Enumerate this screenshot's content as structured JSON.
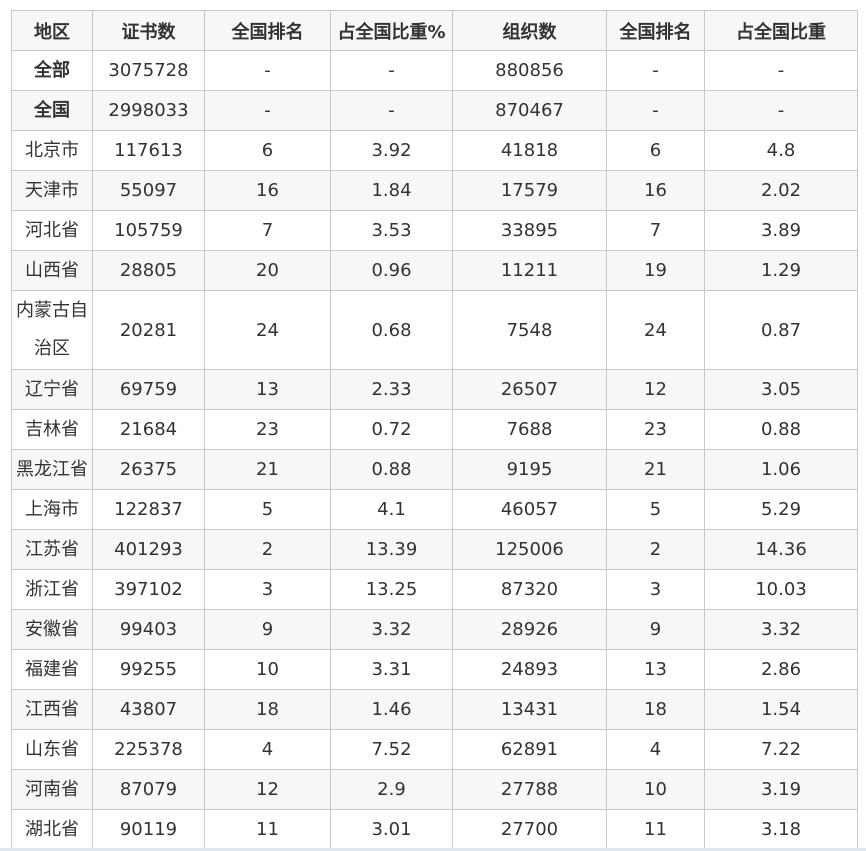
{
  "headers": [
    "地区",
    "证书数",
    "全国排名",
    "占全国比重%",
    "组织数",
    "全国排名",
    "占全国比重"
  ],
  "rows": [
    {
      "region": "全部",
      "bold": true,
      "certs": "3075728",
      "cert_rank": "-",
      "cert_share": "-",
      "orgs": "880856",
      "org_rank": "-",
      "org_share": "-"
    },
    {
      "region": "全国",
      "bold": true,
      "certs": "2998033",
      "cert_rank": "-",
      "cert_share": "-",
      "orgs": "870467",
      "org_rank": "-",
      "org_share": "-"
    },
    {
      "region": "北京市",
      "certs": "117613",
      "cert_rank": "6",
      "cert_share": "3.92",
      "orgs": "41818",
      "org_rank": "6",
      "org_share": "4.8"
    },
    {
      "region": "天津市",
      "certs": "55097",
      "cert_rank": "16",
      "cert_share": "1.84",
      "orgs": "17579",
      "org_rank": "16",
      "org_share": "2.02"
    },
    {
      "region": "河北省",
      "certs": "105759",
      "cert_rank": "7",
      "cert_share": "3.53",
      "orgs": "33895",
      "org_rank": "7",
      "org_share": "3.89"
    },
    {
      "region": "山西省",
      "certs": "28805",
      "cert_rank": "20",
      "cert_share": "0.96",
      "orgs": "11211",
      "org_rank": "19",
      "org_share": "1.29"
    },
    {
      "region": "内蒙古自治区",
      "tall": true,
      "certs": "20281",
      "cert_rank": "24",
      "cert_share": "0.68",
      "orgs": "7548",
      "org_rank": "24",
      "org_share": "0.87"
    },
    {
      "region": "辽宁省",
      "certs": "69759",
      "cert_rank": "13",
      "cert_share": "2.33",
      "orgs": "26507",
      "org_rank": "12",
      "org_share": "3.05"
    },
    {
      "region": "吉林省",
      "certs": "21684",
      "cert_rank": "23",
      "cert_share": "0.72",
      "orgs": "7688",
      "org_rank": "23",
      "org_share": "0.88"
    },
    {
      "region": "黑龙江省",
      "certs": "26375",
      "cert_rank": "21",
      "cert_share": "0.88",
      "orgs": "9195",
      "org_rank": "21",
      "org_share": "1.06"
    },
    {
      "region": "上海市",
      "certs": "122837",
      "cert_rank": "5",
      "cert_share": "4.1",
      "orgs": "46057",
      "org_rank": "5",
      "org_share": "5.29"
    },
    {
      "region": "江苏省",
      "certs": "401293",
      "cert_rank": "2",
      "cert_share": "13.39",
      "orgs": "125006",
      "org_rank": "2",
      "org_share": "14.36"
    },
    {
      "region": "浙江省",
      "certs": "397102",
      "cert_rank": "3",
      "cert_share": "13.25",
      "orgs": "87320",
      "org_rank": "3",
      "org_share": "10.03"
    },
    {
      "region": "安徽省",
      "certs": "99403",
      "cert_rank": "9",
      "cert_share": "3.32",
      "orgs": "28926",
      "org_rank": "9",
      "org_share": "3.32"
    },
    {
      "region": "福建省",
      "certs": "99255",
      "cert_rank": "10",
      "cert_share": "3.31",
      "orgs": "24893",
      "org_rank": "13",
      "org_share": "2.86"
    },
    {
      "region": "江西省",
      "certs": "43807",
      "cert_rank": "18",
      "cert_share": "1.46",
      "orgs": "13431",
      "org_rank": "18",
      "org_share": "1.54"
    },
    {
      "region": "山东省",
      "certs": "225378",
      "cert_rank": "4",
      "cert_share": "7.52",
      "orgs": "62891",
      "org_rank": "4",
      "org_share": "7.22"
    },
    {
      "region": "河南省",
      "certs": "87079",
      "cert_rank": "12",
      "cert_share": "2.9",
      "orgs": "27788",
      "org_rank": "10",
      "org_share": "3.19"
    },
    {
      "region": "湖北省",
      "certs": "90119",
      "cert_rank": "11",
      "cert_share": "3.01",
      "orgs": "27700",
      "org_rank": "11",
      "org_share": "3.18"
    }
  ]
}
